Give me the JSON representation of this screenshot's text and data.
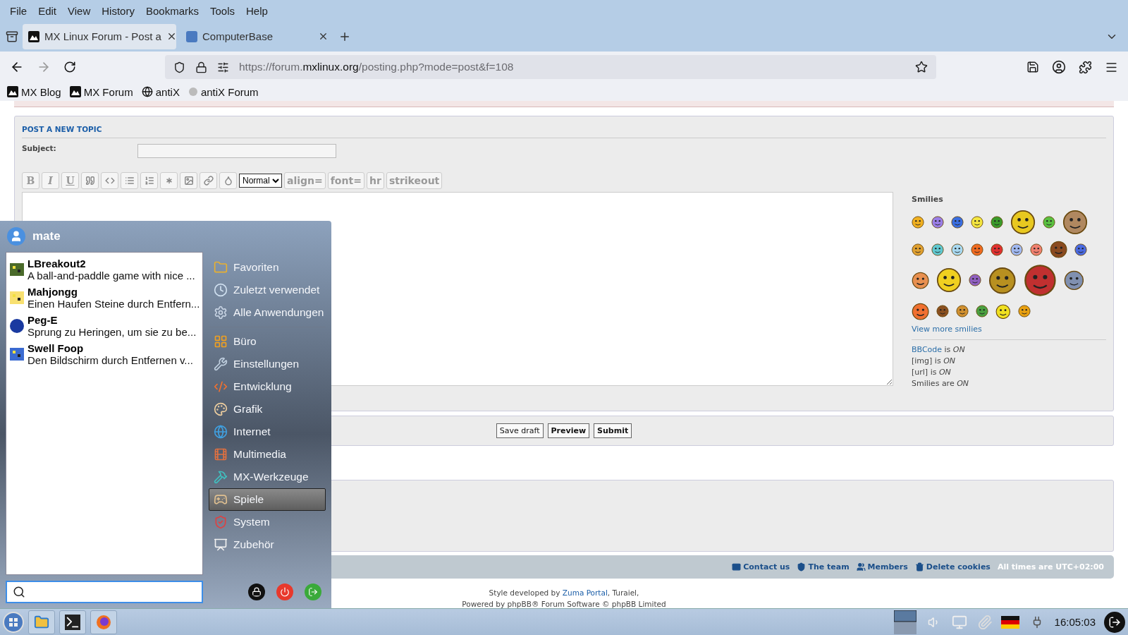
{
  "browser": {
    "menu": [
      "File",
      "Edit",
      "View",
      "History",
      "Bookmarks",
      "Tools",
      "Help"
    ],
    "tabs": [
      {
        "title": "MX Linux Forum - Post a",
        "selected": true
      },
      {
        "title": "ComputerBase",
        "selected": false
      }
    ],
    "url": {
      "prefix": "https://forum.",
      "domain": "mxlinux.org",
      "path": "/posting.php?mode=post&f=108"
    },
    "bookmarks": [
      "MX Blog",
      "MX Forum",
      "antiX",
      "antiX Forum"
    ]
  },
  "forum": {
    "heading": "POST A NEW TOPIC",
    "subject_label": "Subject:",
    "toolbar": {
      "letters": [
        "B",
        "I",
        "U"
      ],
      "size_select": "Normal",
      "text_buttons": [
        "align=",
        "font=",
        "hr",
        "strikeout"
      ]
    },
    "smilies": {
      "title": "Smilies",
      "more_link": "View more smilies",
      "status": [
        {
          "label": "BBCode",
          "linked": true,
          "rest": "is *ON*"
        },
        {
          "label": "[img]",
          "linked": false,
          "rest": "is *ON*"
        },
        {
          "label": "[url]",
          "linked": false,
          "rest": "is *ON*"
        },
        {
          "label": "Smilies",
          "linked": false,
          "rest": "are *ON*"
        }
      ]
    },
    "actions": [
      {
        "label": "Save draft",
        "primary": false
      },
      {
        "label": "Preview",
        "primary": true
      },
      {
        "label": "Submit",
        "primary": true
      }
    ],
    "footer_links": [
      "Contact us",
      "The team",
      "Members",
      "Delete cookies"
    ],
    "timezone": "All times are UTC+02:00",
    "credit": {
      "before": "Style developed by",
      "link": "Zuma Portal",
      "after": ", Turaiel,"
    },
    "powered": "Powered by phpBB® Forum Software © phpBB Limited"
  },
  "start_menu": {
    "user": "mate",
    "apps": [
      {
        "name": "LBreakout2",
        "description": "A ball-and-paddle game with nice ..."
      },
      {
        "name": "Mahjongg",
        "description": "Einen Haufen Steine durch Entfern..."
      },
      {
        "name": "Peg-E",
        "description": "Sprung zu Heringen, um sie zu be..."
      },
      {
        "name": "Swell Foop",
        "description": "Den Bildschirm durch Entfernen v..."
      }
    ],
    "places": [
      {
        "label": "Favoriten",
        "selected": false
      },
      {
        "label": "Zuletzt verwendet",
        "selected": false
      },
      {
        "label": "Alle Anwendungen",
        "selected": false
      }
    ],
    "categories": [
      {
        "label": "Büro",
        "selected": false
      },
      {
        "label": "Einstellungen",
        "selected": false
      },
      {
        "label": "Entwicklung",
        "selected": false
      },
      {
        "label": "Grafik",
        "selected": false
      },
      {
        "label": "Internet",
        "selected": false
      },
      {
        "label": "Multimedia",
        "selected": false
      },
      {
        "label": "MX-Werkzeuge",
        "selected": false
      },
      {
        "label": "Spiele",
        "selected": true
      },
      {
        "label": "System",
        "selected": false
      },
      {
        "label": "Zubehör",
        "selected": false
      }
    ]
  },
  "taskbar": {
    "clock": "16:05:03"
  }
}
